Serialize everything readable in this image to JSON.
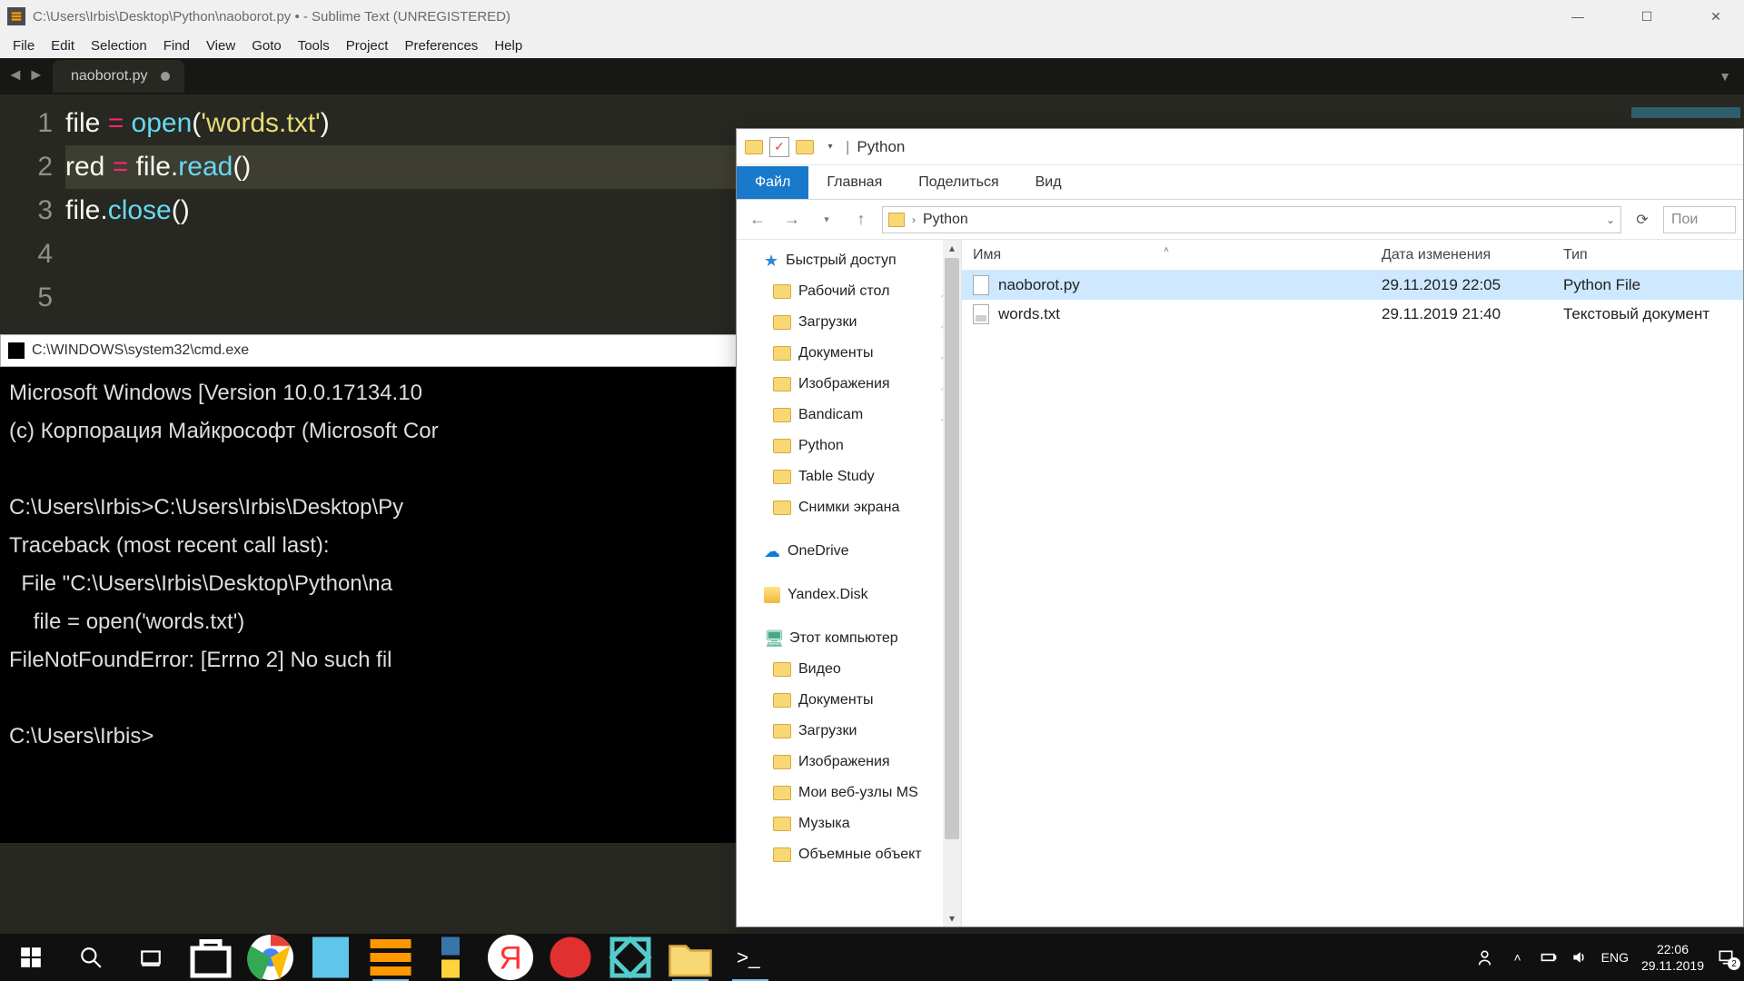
{
  "sublime": {
    "title": "C:\\Users\\Irbis\\Desktop\\Python\\naoborot.py • - Sublime Text (UNREGISTERED)",
    "menu": [
      "File",
      "Edit",
      "Selection",
      "Find",
      "View",
      "Goto",
      "Tools",
      "Project",
      "Preferences",
      "Help"
    ],
    "tab_name": "naoborot.py",
    "gutter": [
      "1",
      "2",
      "3",
      "4",
      "5"
    ],
    "code": {
      "l1": {
        "plain1": "file ",
        "op": "=",
        "fn": " open",
        "paren": "(",
        "str": "'words.txt'",
        "paren2": ")"
      },
      "l2": {
        "plain1": "red ",
        "op": "=",
        "plain2": " file.",
        "fn": "read",
        "parens": "()"
      },
      "l3": {
        "plain1": "file.",
        "fn": "close",
        "parens": "()"
      }
    }
  },
  "cmd": {
    "title": "C:\\WINDOWS\\system32\\cmd.exe",
    "lines": [
      "Microsoft Windows [Version 10.0.17134.10",
      "(c) Корпорация Майкрософт (Microsoft Cor",
      "",
      "C:\\Users\\Irbis>C:\\Users\\Irbis\\Desktop\\Py",
      "Traceback (most recent call last):",
      "  File \"C:\\Users\\Irbis\\Desktop\\Python\\na",
      "    file = open('words.txt')",
      "FileNotFoundError: [Errno 2] No such fil",
      "",
      "C:\\Users\\Irbis>"
    ]
  },
  "explorer": {
    "title": "Python",
    "ribbon": {
      "file": "Файл",
      "home": "Главная",
      "share": "Поделиться",
      "view": "Вид"
    },
    "breadcrumb": "Python",
    "search_placeholder": "Пои",
    "nav": {
      "quick": "Быстрый доступ",
      "items_pinned": [
        "Рабочий стол",
        "Загрузки",
        "Документы",
        "Изображения",
        "Bandicam"
      ],
      "items_unpinned": [
        "Python",
        "Table Study",
        "Снимки экрана"
      ],
      "onedrive": "OneDrive",
      "yandex": "Yandex.Disk",
      "thispc": "Этот компьютер",
      "pc_items": [
        "Видео",
        "Документы",
        "Загрузки",
        "Изображения",
        "Мои веб-узлы MS",
        "Музыка",
        "Объемные объект"
      ]
    },
    "columns": {
      "name": "Имя",
      "date": "Дата изменения",
      "type": "Тип"
    },
    "files": [
      {
        "name": "naoborot.py",
        "date": "29.11.2019 22:05",
        "type": "Python File",
        "selected": true,
        "icon": "py"
      },
      {
        "name": "words.txt",
        "date": "29.11.2019 21:40",
        "type": "Текстовый документ",
        "selected": false,
        "icon": "txt"
      }
    ]
  },
  "taskbar": {
    "lang": "ENG",
    "time": "22:06",
    "date": "29.11.2019",
    "notif_count": "2"
  }
}
